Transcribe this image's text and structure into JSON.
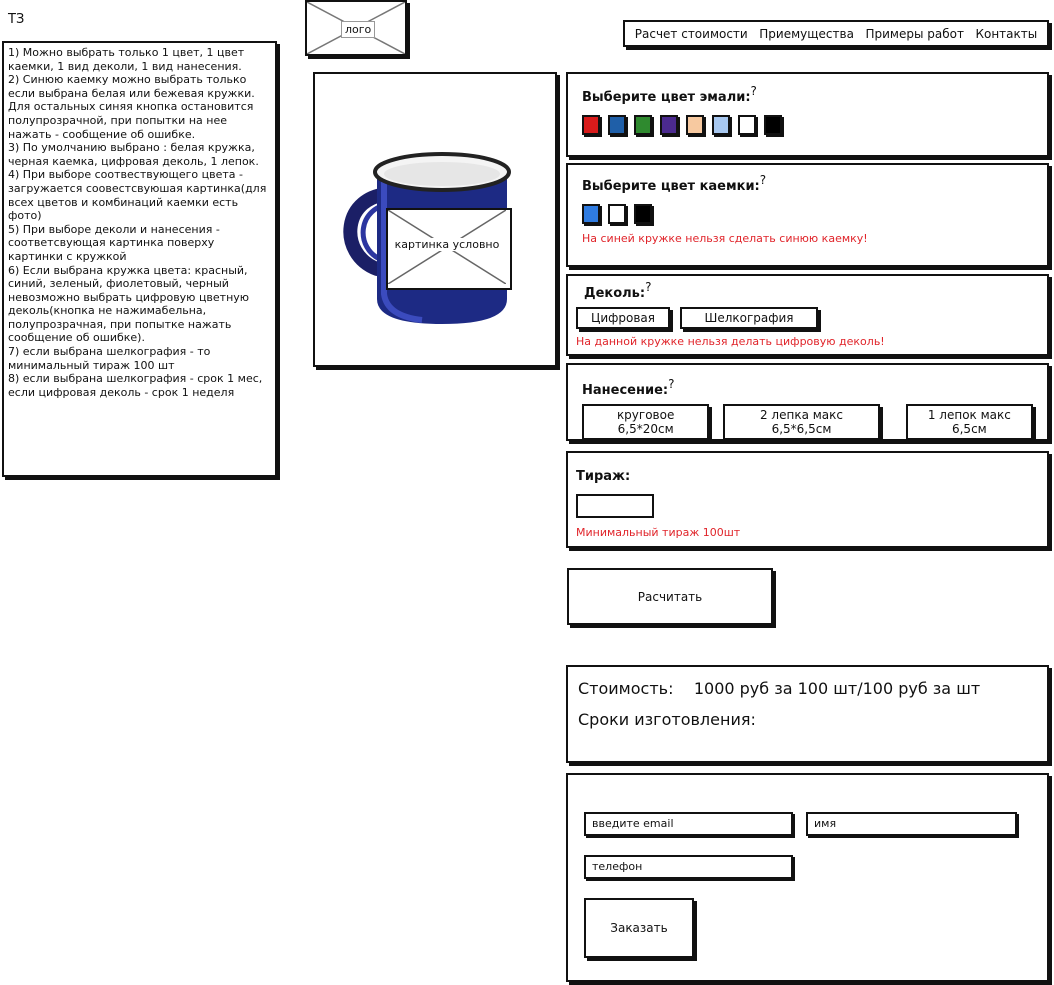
{
  "tz": {
    "label": "ТЗ",
    "items": [
      "1) Можно выбрать только 1 цвет, 1 цвет каемки, 1 вид деколи, 1 вид нанесения.",
      "2) Синюю каемку можно выбрать только если выбрана белая или бежевая кружки. Для остальных синяя кнопка остановится полупрозрачной, при попытки на нее нажать - сообщение об ошибке.",
      "3) По умолчанию выбрано : белая кружка, черная каемка, цифровая деколь, 1 лепок.",
      "4) При выборе соотвествующего цвета - загружается соовестсвуюшая картинка(для всех цветов и комбинаций каемки есть фото)",
      "5) При выборе деколи и нанесения - соответсвующая картинка поверху картинки с кружкой",
      "6) Если выбрана кружка цвета: красный, синий, зеленый, фиолетовый, черный невозможно выбрать цифровую цветную деколь(кнопка не нажимабельна, полупрозрачная, при попытке нажать сообщение об ошибке).",
      "7) если выбрана шелкография - то минимальный тираж 100 шт",
      "8) если выбрана шелкография - срок 1 мес, если цифровая деколь - срок 1 неделя"
    ]
  },
  "logo": {
    "label": "лого"
  },
  "nav": {
    "items": [
      "Расчет стоимости",
      "Приемущества",
      "Примеры работ",
      "Контакты"
    ]
  },
  "preview": {
    "placeholder": "картинка условно"
  },
  "enamel": {
    "title": "Выберите цвет эмали:",
    "help": "?",
    "colors": [
      "#d81b1b",
      "#1f5fa8",
      "#2f8a2f",
      "#4b2a8f",
      "#f7c9a0",
      "#a8c8f0",
      "#ffffff",
      "#000000"
    ]
  },
  "rim": {
    "title": "Выберите цвет каемки:",
    "help": "?",
    "colors": [
      "#2f7be0",
      "#ffffff",
      "#000000"
    ],
    "error": "На синей кружке нельзя сделать синюю каемку!"
  },
  "decal": {
    "title": "Деколь:",
    "help": "?",
    "options": [
      "Цифровая",
      "Шелкография"
    ],
    "error": "На данной кружке нельзя делать цифровую деколь!"
  },
  "application": {
    "title": "Нанесение:",
    "help": "?",
    "options": [
      "круговое 6,5*20см",
      "2 лепка макс 6,5*6,5см",
      "1 лепок макс 6,5см"
    ]
  },
  "run": {
    "title": "Тираж:",
    "value": "",
    "error": "Минимальный тираж 100шт"
  },
  "calculate": {
    "label": "Расчитать"
  },
  "cost": {
    "price_label": "Стоимость:",
    "price_value": "1000 руб за 100 шт/100 руб за шт",
    "term_label": "Сроки изготовления:"
  },
  "order": {
    "email_placeholder": "введите email",
    "name_placeholder": "имя",
    "phone_placeholder": "телефон",
    "button": "Заказать"
  }
}
